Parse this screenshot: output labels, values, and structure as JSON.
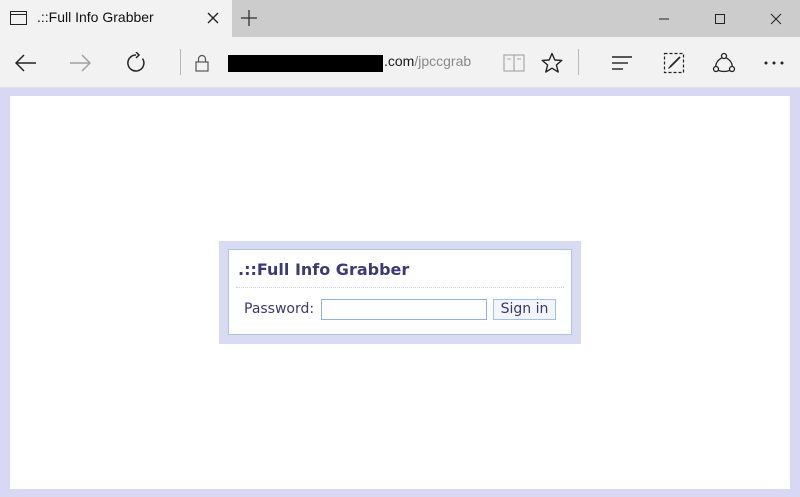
{
  "browser": {
    "tab": {
      "title": ".::Full Info Grabber"
    },
    "address_bar": {
      "visible_domain_suffix": ".com",
      "visible_path": "/jpccgrab"
    }
  },
  "login": {
    "heading": ".::Full Info Grabber",
    "password_label": "Password:",
    "password_value": "",
    "sign_in_label": "Sign in"
  },
  "colors": {
    "page_background_frame": "#d8d8f4",
    "login_frame": "#d9dbf2",
    "login_border": "#a9c6e8",
    "heading_text": "#3a3a78",
    "tab_active": "#f2f2f2",
    "tabbar": "#cccccc"
  },
  "icons": {
    "tab_page": "page-icon",
    "tab_close": "close-icon",
    "new_tab": "plus-icon",
    "back": "arrow-left-icon",
    "forward": "arrow-right-icon",
    "refresh": "refresh-icon",
    "lock": "lock-icon",
    "reading_view": "book-icon",
    "favorite": "star-icon",
    "hub": "hub-icon",
    "web_note": "pen-note-icon",
    "share": "share-icon",
    "more": "more-icon"
  }
}
